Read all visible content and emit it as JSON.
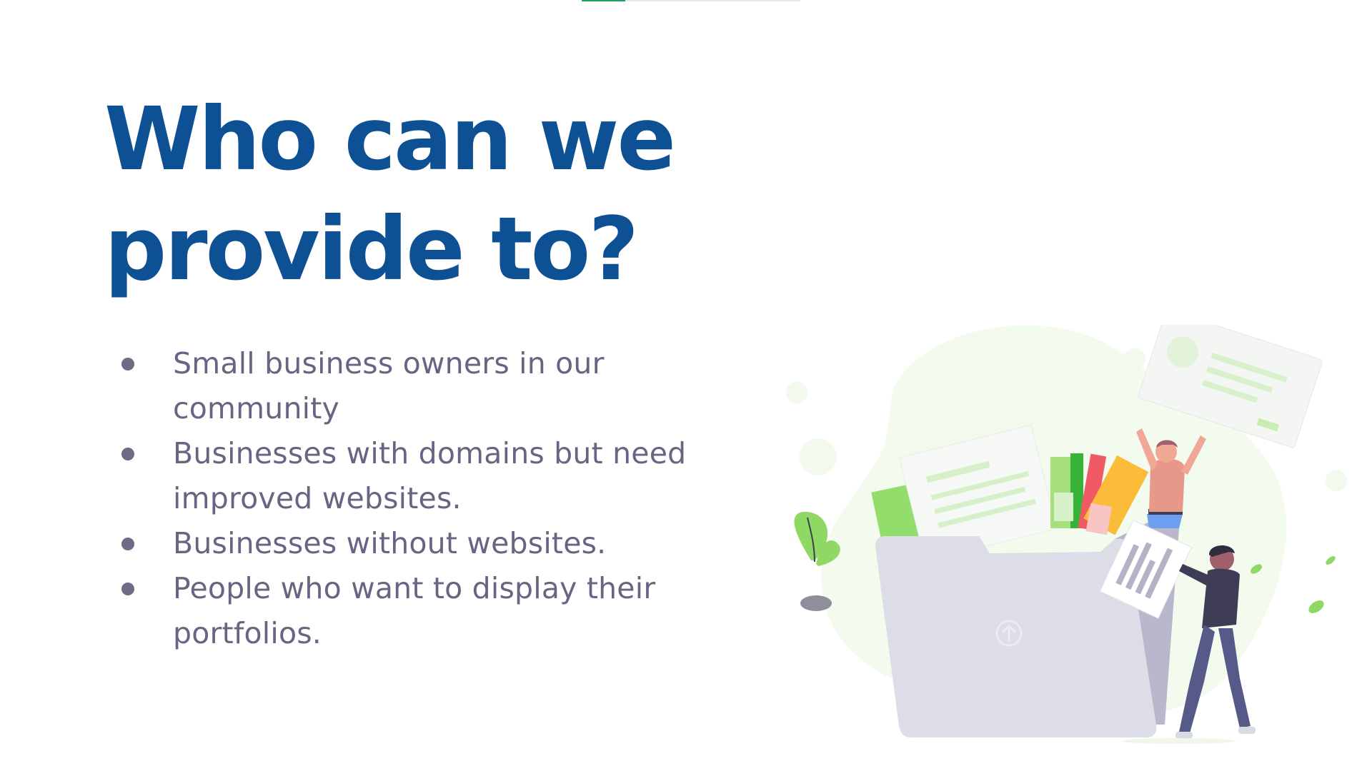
{
  "progress": {
    "fraction": 0.2,
    "fill_color": "#1aa260"
  },
  "slide": {
    "title_line1": "Who can we",
    "title_line2": "provide to?",
    "bullets": [
      "Small business owners in our community",
      "Businesses with domains but need improved websites.",
      "Businesses without websites.",
      "People who want to display their portfolios."
    ]
  },
  "colors": {
    "title": "#0d5094",
    "body_text": "#6a6482",
    "accent_green": "#8fd86b"
  },
  "illustration": {
    "icon": "upload-folder-illustration"
  }
}
